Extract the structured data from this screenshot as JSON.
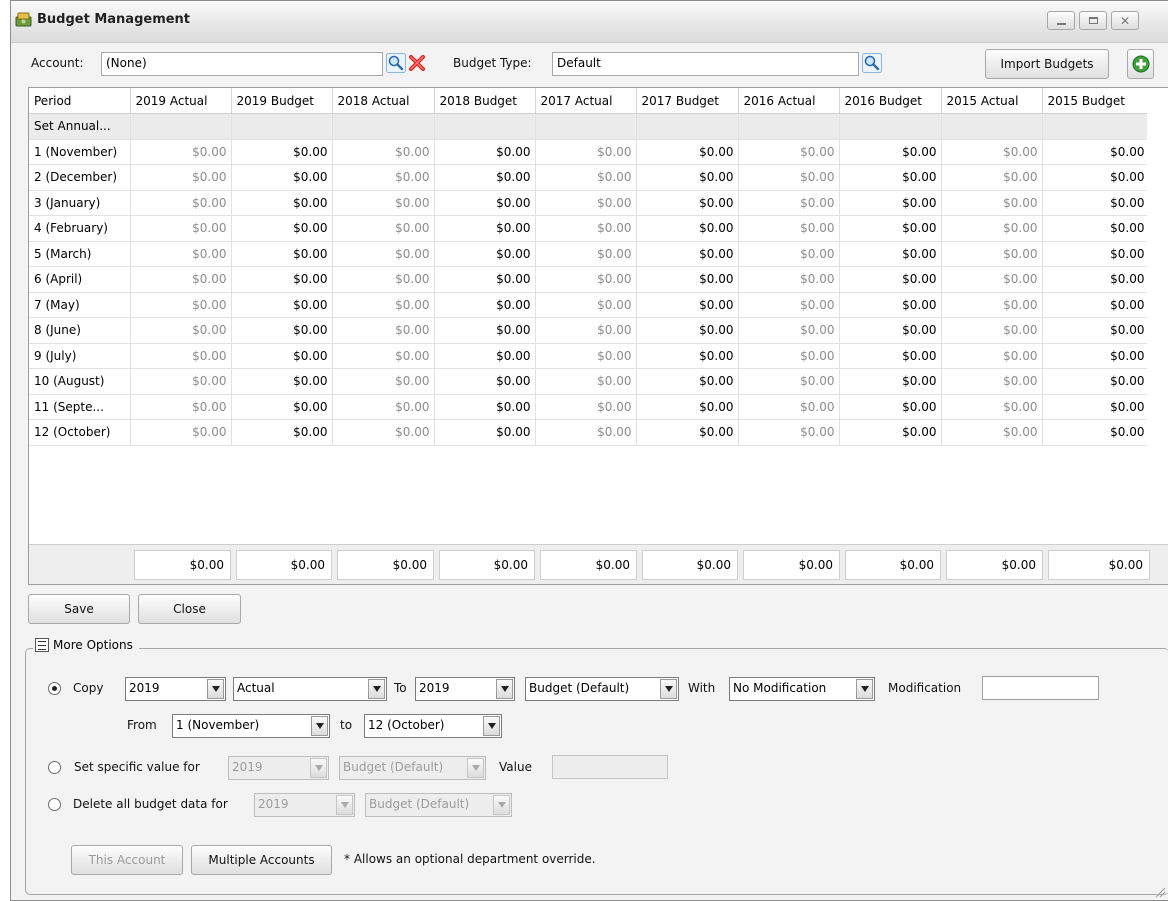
{
  "window": {
    "title": "Budget Management",
    "controls": [
      "minimize-icon",
      "maximize-icon",
      "close-icon"
    ]
  },
  "toolbar": {
    "account_label": "Account:",
    "account_value": "(None)",
    "budget_type_label": "Budget Type:",
    "budget_type_value": "Default",
    "import_label": "Import Budgets"
  },
  "grid": {
    "columns": [
      "Period",
      "2019 Actual",
      "2019 Budget",
      "2018 Actual",
      "2018 Budget",
      "2017 Actual",
      "2017 Budget",
      "2016 Actual",
      "2016 Budget",
      "2015 Actual",
      "2015 Budget"
    ],
    "annual_row_label": "Set Annual...",
    "rows": [
      {
        "period": "1 (November)",
        "values": [
          "$0.00",
          "$0.00",
          "$0.00",
          "$0.00",
          "$0.00",
          "$0.00",
          "$0.00",
          "$0.00",
          "$0.00",
          "$0.00"
        ]
      },
      {
        "period": "2 (December)",
        "values": [
          "$0.00",
          "$0.00",
          "$0.00",
          "$0.00",
          "$0.00",
          "$0.00",
          "$0.00",
          "$0.00",
          "$0.00",
          "$0.00"
        ]
      },
      {
        "period": "3 (January)",
        "values": [
          "$0.00",
          "$0.00",
          "$0.00",
          "$0.00",
          "$0.00",
          "$0.00",
          "$0.00",
          "$0.00",
          "$0.00",
          "$0.00"
        ]
      },
      {
        "period": "4 (February)",
        "values": [
          "$0.00",
          "$0.00",
          "$0.00",
          "$0.00",
          "$0.00",
          "$0.00",
          "$0.00",
          "$0.00",
          "$0.00",
          "$0.00"
        ]
      },
      {
        "period": "5 (March)",
        "values": [
          "$0.00",
          "$0.00",
          "$0.00",
          "$0.00",
          "$0.00",
          "$0.00",
          "$0.00",
          "$0.00",
          "$0.00",
          "$0.00"
        ]
      },
      {
        "period": "6 (April)",
        "values": [
          "$0.00",
          "$0.00",
          "$0.00",
          "$0.00",
          "$0.00",
          "$0.00",
          "$0.00",
          "$0.00",
          "$0.00",
          "$0.00"
        ]
      },
      {
        "period": "7 (May)",
        "values": [
          "$0.00",
          "$0.00",
          "$0.00",
          "$0.00",
          "$0.00",
          "$0.00",
          "$0.00",
          "$0.00",
          "$0.00",
          "$0.00"
        ]
      },
      {
        "period": "8 (June)",
        "values": [
          "$0.00",
          "$0.00",
          "$0.00",
          "$0.00",
          "$0.00",
          "$0.00",
          "$0.00",
          "$0.00",
          "$0.00",
          "$0.00"
        ]
      },
      {
        "period": "9 (July)",
        "values": [
          "$0.00",
          "$0.00",
          "$0.00",
          "$0.00",
          "$0.00",
          "$0.00",
          "$0.00",
          "$0.00",
          "$0.00",
          "$0.00"
        ]
      },
      {
        "period": "10 (August)",
        "values": [
          "$0.00",
          "$0.00",
          "$0.00",
          "$0.00",
          "$0.00",
          "$0.00",
          "$0.00",
          "$0.00",
          "$0.00",
          "$0.00"
        ]
      },
      {
        "period": "11 (Septe...",
        "values": [
          "$0.00",
          "$0.00",
          "$0.00",
          "$0.00",
          "$0.00",
          "$0.00",
          "$0.00",
          "$0.00",
          "$0.00",
          "$0.00"
        ]
      },
      {
        "period": "12 (October)",
        "values": [
          "$0.00",
          "$0.00",
          "$0.00",
          "$0.00",
          "$0.00",
          "$0.00",
          "$0.00",
          "$0.00",
          "$0.00",
          "$0.00"
        ]
      }
    ],
    "totals": [
      "$0.00",
      "$0.00",
      "$0.00",
      "$0.00",
      "$0.00",
      "$0.00",
      "$0.00",
      "$0.00",
      "$0.00",
      "$0.00"
    ]
  },
  "actions": {
    "save_label": "Save",
    "close_label": "Close"
  },
  "more_options": {
    "legend": "More Options",
    "copy": {
      "label": "Copy",
      "year_from": "2019",
      "type_from": "Actual",
      "to_label": "To",
      "year_to": "2019",
      "type_to": "Budget (Default)",
      "with_label": "With",
      "modification_mode": "No Modification",
      "modification_label": "Modification",
      "modification_value": "",
      "from_label": "From",
      "period_from": "1 (November)",
      "to_lower_label": "to",
      "period_to": "12 (October)"
    },
    "set_specific": {
      "label": "Set specific value for",
      "year": "2019",
      "type": "Budget (Default)",
      "value_label": "Value",
      "value": ""
    },
    "delete_all": {
      "label": "Delete all budget data for",
      "year": "2019",
      "type": "Budget (Default)"
    },
    "this_account_label": "This Account",
    "multiple_accounts_label": "Multiple Accounts",
    "note": "* Allows an optional department override."
  }
}
